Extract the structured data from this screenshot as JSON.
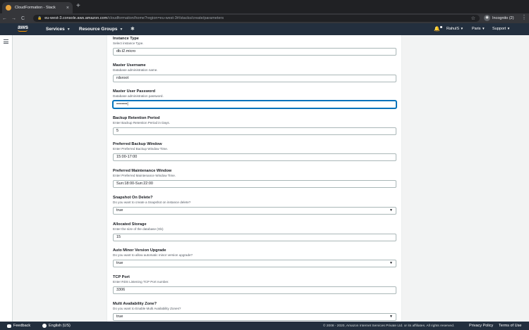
{
  "browser": {
    "tab_title": "CloudFormation - Stack",
    "tab_close": "×",
    "new_tab": "+",
    "back": "←",
    "forward": "→",
    "reload": "C",
    "url_host": "eu-west-3.console.aws.amazon.com",
    "url_rest": "/cloudformation/home?region=eu-west-3#/stacks/create/parameters",
    "incognito_label": "Incognito (2)"
  },
  "aws_nav": {
    "logo": "aws",
    "services": "Services",
    "resource_groups": "Resource Groups",
    "user": "RahulS",
    "region": "Paris",
    "support": "Support"
  },
  "form": {
    "fields": [
      {
        "label": "Instance Type",
        "description": "Select instance Type.",
        "value": "db.t2.micro"
      },
      {
        "label": "Master Username",
        "description": "Database administration name.",
        "value": "rdsroot"
      },
      {
        "label": "Master User Password",
        "description": "Database administration password.",
        "value": "••••••••|"
      },
      {
        "label": "Backup Retention Period",
        "description": "Enter Backup Retention Period in Days.",
        "value": "5"
      },
      {
        "label": "Preferred Backup Window",
        "description": "Enter Preferred Backup Window Time.",
        "value": "15:00-17:00"
      },
      {
        "label": "Preferred Maintenance Window",
        "description": "Enter Preferred Maintenance Window Time.",
        "value": "Sun:18:00-Sun:22:00"
      },
      {
        "label": "Snapshot On Delete?",
        "description": "Do you want to create a Snapshot on instance delete?",
        "value": "true"
      },
      {
        "label": "Allocated Storage",
        "description": "Enter the size of the database (Gb)",
        "value": "15"
      },
      {
        "label": "Auto Minor Version Upgrade",
        "description": "Do you want to allow automatic minor version upgrade?",
        "value": "true"
      },
      {
        "label": "TCP Port",
        "description": "Enter RDS Listening TCP Port number.",
        "value": "3306"
      },
      {
        "label": "Multi Availability Zone?",
        "description": "Do you want to Enable Multi Availability Zones?",
        "value": "true"
      }
    ]
  },
  "footer": {
    "feedback": "Feedback",
    "language": "English (US)",
    "copyright": "© 2008 - 2020, Amazon Internet Services Private Ltd. or its affiliates. All rights reserved.",
    "privacy": "Privacy Policy",
    "terms": "Terms of Use"
  },
  "colors": {
    "aws_nav": "#232f3e",
    "aws_orange": "#ff9900",
    "focus_blue": "#0073bb"
  }
}
